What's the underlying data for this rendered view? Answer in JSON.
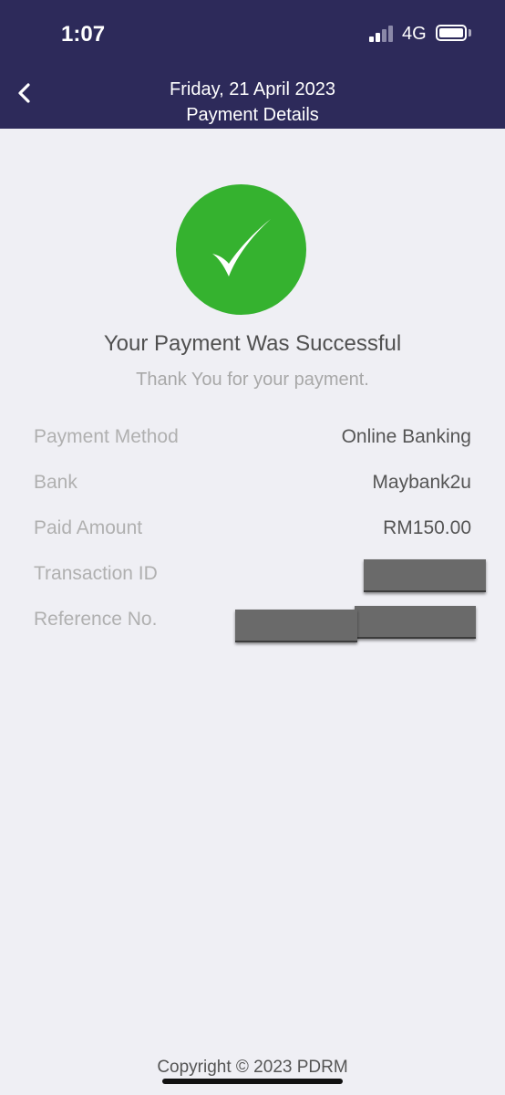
{
  "status_bar": {
    "time": "1:07",
    "network": "4G"
  },
  "header": {
    "date": "Friday, 21 April 2023",
    "title": "Payment Details"
  },
  "result": {
    "headline": "Your Payment Was Successful",
    "subline": "Thank You for your payment.",
    "accent_color": "#35b22f"
  },
  "details": [
    {
      "label": "Payment Method",
      "value": "Online Banking"
    },
    {
      "label": "Bank",
      "value": "Maybank2u"
    },
    {
      "label": "Paid Amount",
      "value": "RM150.00"
    },
    {
      "label": "Transaction ID",
      "value": ""
    },
    {
      "label": "Reference No.",
      "value": ""
    }
  ],
  "footer": {
    "copyright": "Copyright © 2023 PDRM"
  },
  "colors": {
    "header_bg": "#2d2a5a",
    "page_bg": "#efeff4"
  }
}
